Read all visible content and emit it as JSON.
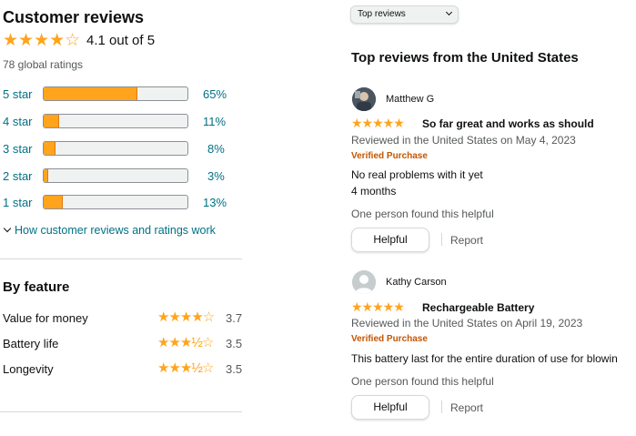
{
  "summary": {
    "title": "Customer reviews",
    "rating_value": 4.1,
    "rating_text": "4.1 out of 5",
    "global_ratings": "78 global ratings"
  },
  "histogram": [
    {
      "label": "5 star",
      "percent": 65,
      "percent_text": "65%"
    },
    {
      "label": "4 star",
      "percent": 11,
      "percent_text": "11%"
    },
    {
      "label": "3 star",
      "percent": 8,
      "percent_text": "8%"
    },
    {
      "label": "2 star",
      "percent": 3,
      "percent_text": "3%"
    },
    {
      "label": "1 star",
      "percent": 13,
      "percent_text": "13%"
    }
  ],
  "how_it_works_link": "How customer reviews and ratings work",
  "by_feature": {
    "title": "By feature",
    "items": [
      {
        "label": "Value for money",
        "rating": 3.7,
        "value_text": "3.7"
      },
      {
        "label": "Battery life",
        "rating": 3.5,
        "value_text": "3.5"
      },
      {
        "label": "Longevity",
        "rating": 3.5,
        "value_text": "3.5"
      }
    ]
  },
  "sort_dropdown": {
    "selected": "Top reviews"
  },
  "top_reviews_heading": "Top reviews from the United States",
  "reviews": [
    {
      "author": "Matthew G",
      "rating": 5,
      "title": "So far great and works as should",
      "meta": "Reviewed in the United States on May 4, 2023",
      "verified": "Verified Purchase",
      "body_lines": [
        "No real problems with it yet",
        "4 months"
      ],
      "helpful_count": "One person found this helpful",
      "helpful_label": "Helpful",
      "report_label": "Report"
    },
    {
      "author": "Kathy Carson",
      "rating": 5,
      "title": "Rechargeable Battery",
      "meta": "Reviewed in the United States on April 19, 2023",
      "verified": "Verified Purchase",
      "body_lines": [
        "This battery last for the entire duration of use for blowin"
      ],
      "helpful_count": "One person found this helpful",
      "helpful_label": "Helpful",
      "report_label": "Report"
    }
  ],
  "colors": {
    "star": "#ffa41c",
    "link": "#007185",
    "verified": "#c45500"
  },
  "icons": [
    "star-icon",
    "chevron-down-icon",
    "avatar-icon",
    "default-avatar-icon"
  ]
}
